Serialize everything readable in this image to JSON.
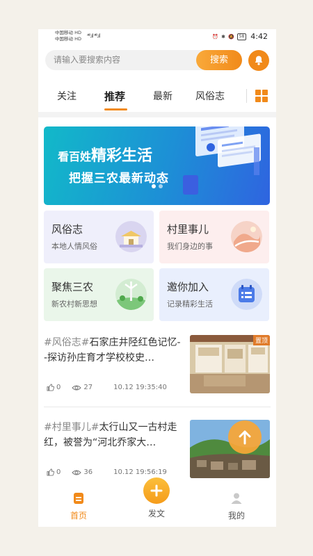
{
  "status_bar": {
    "carrier1": "中国移动 HD",
    "carrier2": "中国移动 HD",
    "signal": "⁴⁶.ıl ⁴⁶.ıl",
    "battery": "58",
    "time": "4:42"
  },
  "search": {
    "placeholder": "请输入要搜索内容",
    "button_label": "搜索"
  },
  "tabs": [
    {
      "label": "关注"
    },
    {
      "label": "推荐"
    },
    {
      "label": "最新"
    },
    {
      "label": "风俗志"
    }
  ],
  "banner": {
    "line1_prefix": "看百姓",
    "line1_highlight": "精彩生活",
    "line2": "把握三农最新动态"
  },
  "cards": [
    {
      "title": "风俗志",
      "subtitle": "本地人情风俗",
      "bg": "#efeffb"
    },
    {
      "title": "村里事儿",
      "subtitle": "我们身边的事",
      "bg": "#fdeeee"
    },
    {
      "title": "聚焦三农",
      "subtitle": "新农村新思想",
      "bg": "#eaf6ea"
    },
    {
      "title": "邀你加入",
      "subtitle": "记录精彩生活",
      "bg": "#e9effd"
    }
  ],
  "articles": [
    {
      "tag": "#风俗志#",
      "title": "石家庄井陉红色记忆--探访孙庄育才学校校史…",
      "likes": "0",
      "views": "27",
      "datetime": "10.12 19:35:40",
      "badge": "置顶"
    },
    {
      "tag": "#村里事儿#",
      "title": "太行山又一古村走红，被誉为“河北乔家大…",
      "likes": "0",
      "views": "36",
      "datetime": "10.12 19:56:19"
    }
  ],
  "bottom_nav": {
    "home": "首页",
    "post": "发文",
    "mine": "我的"
  },
  "colors": {
    "accent": "#f18a1a",
    "banner_start": "#12b9c9",
    "banner_end": "#2f64e0"
  }
}
